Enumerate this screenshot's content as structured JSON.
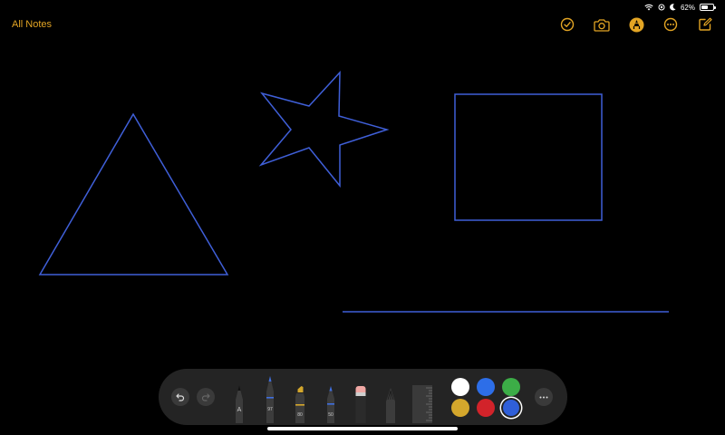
{
  "status": {
    "battery_text": "62%",
    "battery_level": 0.62
  },
  "nav": {
    "back_label": "All Notes"
  },
  "colors": {
    "accent": "#e3a524",
    "stroke": "#3f5fd8",
    "background": "#000000",
    "palette_bg": "#242424"
  },
  "top_toolbar": [
    {
      "name": "checklist-icon"
    },
    {
      "name": "camera-icon"
    },
    {
      "name": "markup-pen-icon",
      "active": true
    },
    {
      "name": "more-icon"
    },
    {
      "name": "compose-icon"
    }
  ],
  "drawing": {
    "shapes": [
      "triangle",
      "star",
      "square",
      "line"
    ]
  },
  "tools": {
    "items": [
      {
        "name": "monoline-pen",
        "label": "A"
      },
      {
        "name": "pen",
        "label": "97"
      },
      {
        "name": "marker",
        "label": "80"
      },
      {
        "name": "pencil",
        "label": "50"
      },
      {
        "name": "eraser",
        "label": ""
      },
      {
        "name": "lasso",
        "label": ""
      },
      {
        "name": "ruler",
        "label": ""
      }
    ]
  },
  "palette_colors": [
    {
      "name": "white",
      "hex": "#ffffff"
    },
    {
      "name": "blue",
      "hex": "#2d6ee8"
    },
    {
      "name": "green",
      "hex": "#3cad47"
    },
    {
      "name": "yellow",
      "hex": "#d4a72c"
    },
    {
      "name": "red",
      "hex": "#d2232a"
    },
    {
      "name": "custom",
      "hex": "#2f5fd9",
      "selected": true
    }
  ]
}
